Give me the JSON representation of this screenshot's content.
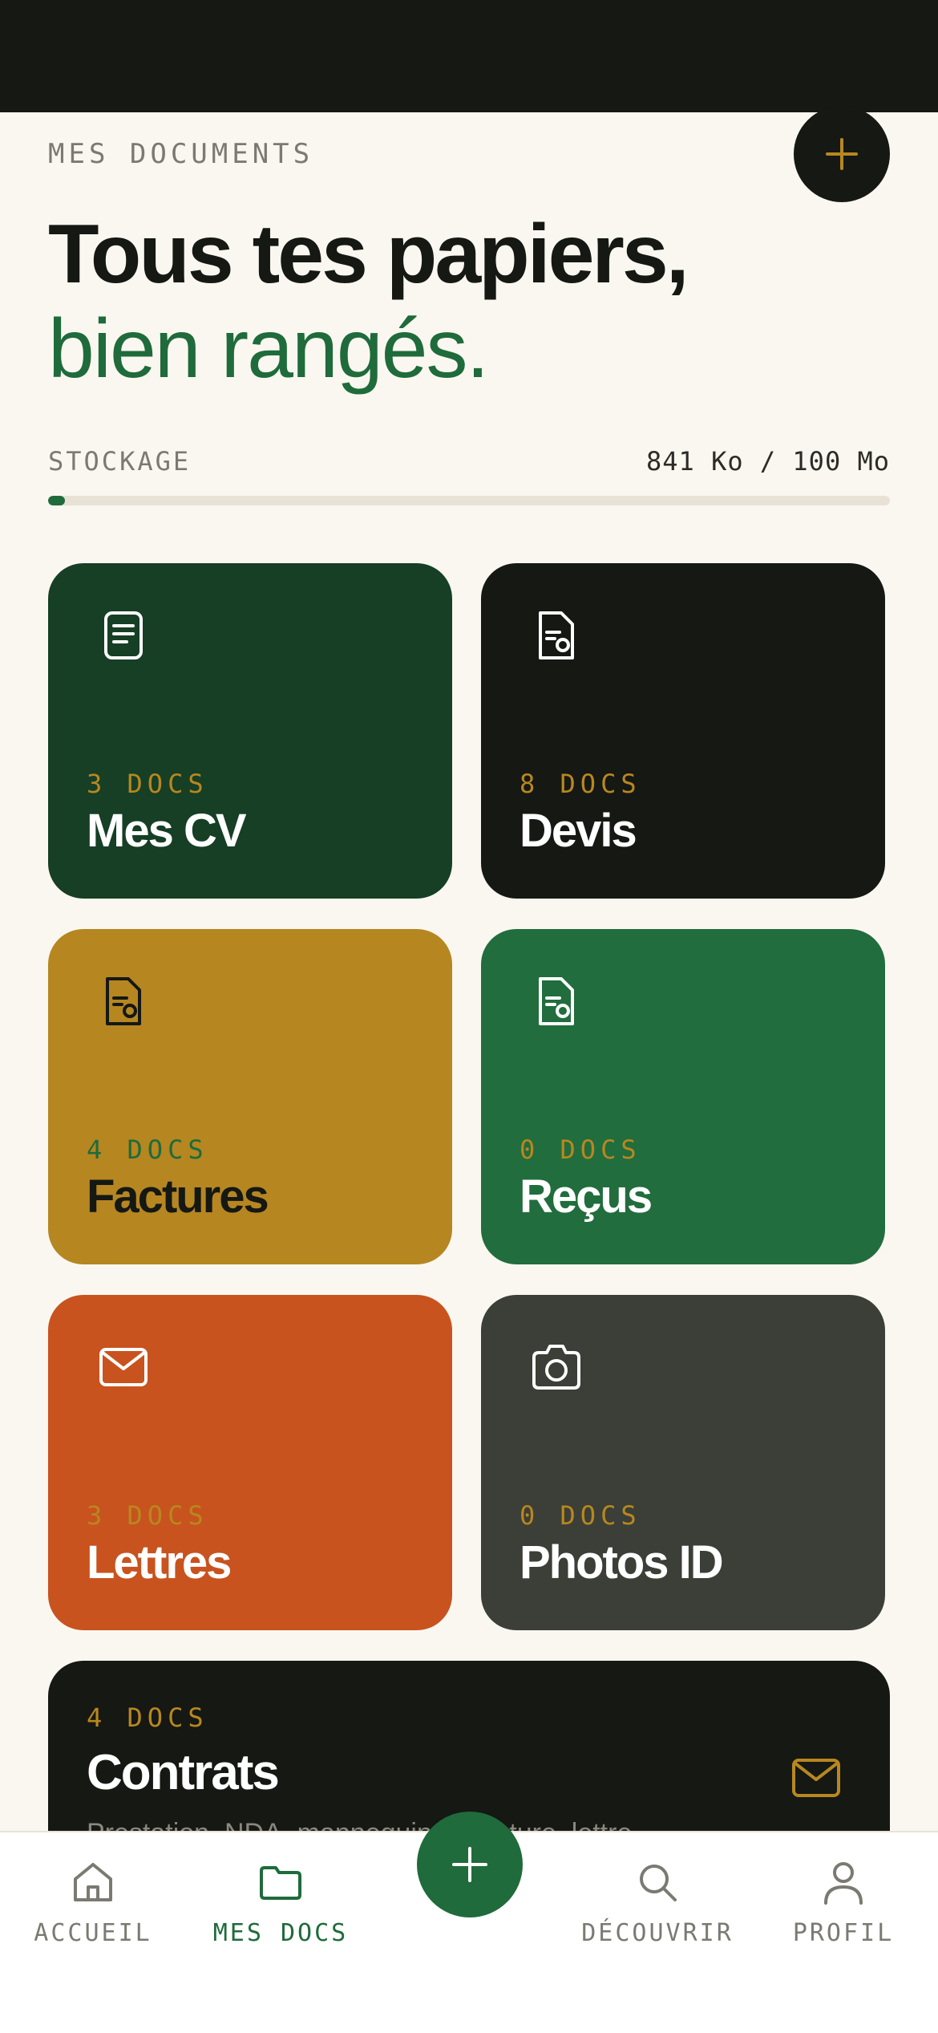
{
  "header": {
    "eyebrow": "MES DOCUMENTS",
    "title_line1": "Tous tes papiers,",
    "title_line2": "bien rangés."
  },
  "storage": {
    "label": "STOCKAGE",
    "value": "841 Ko / 100 Mo",
    "used_fraction": 0.02
  },
  "categories": [
    {
      "count": "3 DOCS",
      "name": "Mes CV",
      "icon": "document-lines-icon",
      "bg": "#163f25",
      "count_color": "#b8871f",
      "name_color": "#ffffff"
    },
    {
      "count": "8 DOCS",
      "name": "Devis",
      "icon": "document-search-icon",
      "bg": "#151813",
      "count_color": "#b8871f",
      "name_color": "#ffffff"
    },
    {
      "count": "4 DOCS",
      "name": "Factures",
      "icon": "document-search-icon",
      "bg": "#b68621",
      "count_color": "#1f6b3b",
      "name_color": "#151813"
    },
    {
      "count": "0 DOCS",
      "name": "Reçus",
      "icon": "document-search-icon",
      "bg": "#216d3d",
      "count_color": "#b8871f",
      "name_color": "#ffffff"
    },
    {
      "count": "3 DOCS",
      "name": "Lettres",
      "icon": "envelope-icon",
      "bg": "#c8531e",
      "count_color": "#b8871f",
      "name_color": "#ffffff"
    },
    {
      "count": "0 DOCS",
      "name": "Photos ID",
      "icon": "camera-icon",
      "bg": "#3b3f37",
      "count_color": "#b8871f",
      "name_color": "#ffffff"
    }
  ],
  "contracts": {
    "count": "4 DOCS",
    "name": "Contrats",
    "desc": "Prestation, NDA, mannequinat, rupture, lettre…",
    "icon": "envelope-icon"
  },
  "nav": {
    "items": [
      {
        "label": "ACCUEIL",
        "icon": "home-icon"
      },
      {
        "label": "MES DOCS",
        "icon": "folder-icon",
        "active": true
      },
      {
        "label": "DÉCOUVRIR",
        "icon": "search-icon"
      },
      {
        "label": "PROFIL",
        "icon": "user-icon"
      }
    ]
  },
  "colors": {
    "accent_green": "#1f6b3b",
    "accent_gold": "#b8871f",
    "ink": "#151813",
    "paper": "#faf7f0"
  }
}
